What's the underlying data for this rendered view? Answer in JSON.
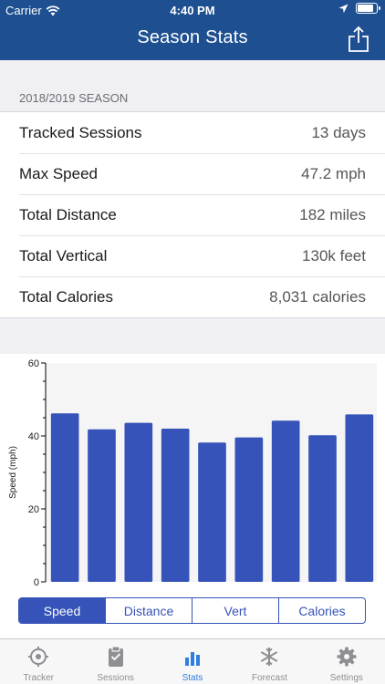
{
  "status_bar": {
    "carrier": "Carrier",
    "time": "4:40 PM",
    "battery_level": 0.9
  },
  "nav": {
    "title": "Season Stats"
  },
  "season_label": "2018/2019 SEASON",
  "stats": [
    {
      "label": "Tracked Sessions",
      "value": "13 days"
    },
    {
      "label": "Max Speed",
      "value": "47.2 mph"
    },
    {
      "label": "Total Distance",
      "value": "182 miles"
    },
    {
      "label": "Total Vertical",
      "value": "130k feet"
    },
    {
      "label": "Total Calories",
      "value": "8,031 calories"
    }
  ],
  "chart_data": {
    "type": "bar",
    "ylabel": "Speed (mph)",
    "ylim": [
      0,
      60
    ],
    "yticks": [
      0,
      20,
      40,
      60
    ],
    "values": [
      46.2,
      41.8,
      43.6,
      42.0,
      38.2,
      39.6,
      44.2,
      40.2,
      45.9
    ],
    "grid": false,
    "bar_color": "#3553b8"
  },
  "segments": {
    "options": [
      "Speed",
      "Distance",
      "Vert",
      "Calories"
    ],
    "selected": "Speed"
  },
  "tabs": [
    {
      "label": "Tracker",
      "icon": "crosshair-icon"
    },
    {
      "label": "Sessions",
      "icon": "clipboard-icon"
    },
    {
      "label": "Stats",
      "icon": "bar-chart-icon"
    },
    {
      "label": "Forecast",
      "icon": "snowflake-icon"
    },
    {
      "label": "Settings",
      "icon": "gear-icon"
    }
  ],
  "active_tab": "Stats",
  "colors": {
    "nav_bg": "#1d4f91",
    "accent": "#3553b8",
    "tab_active": "#2f7de1"
  }
}
